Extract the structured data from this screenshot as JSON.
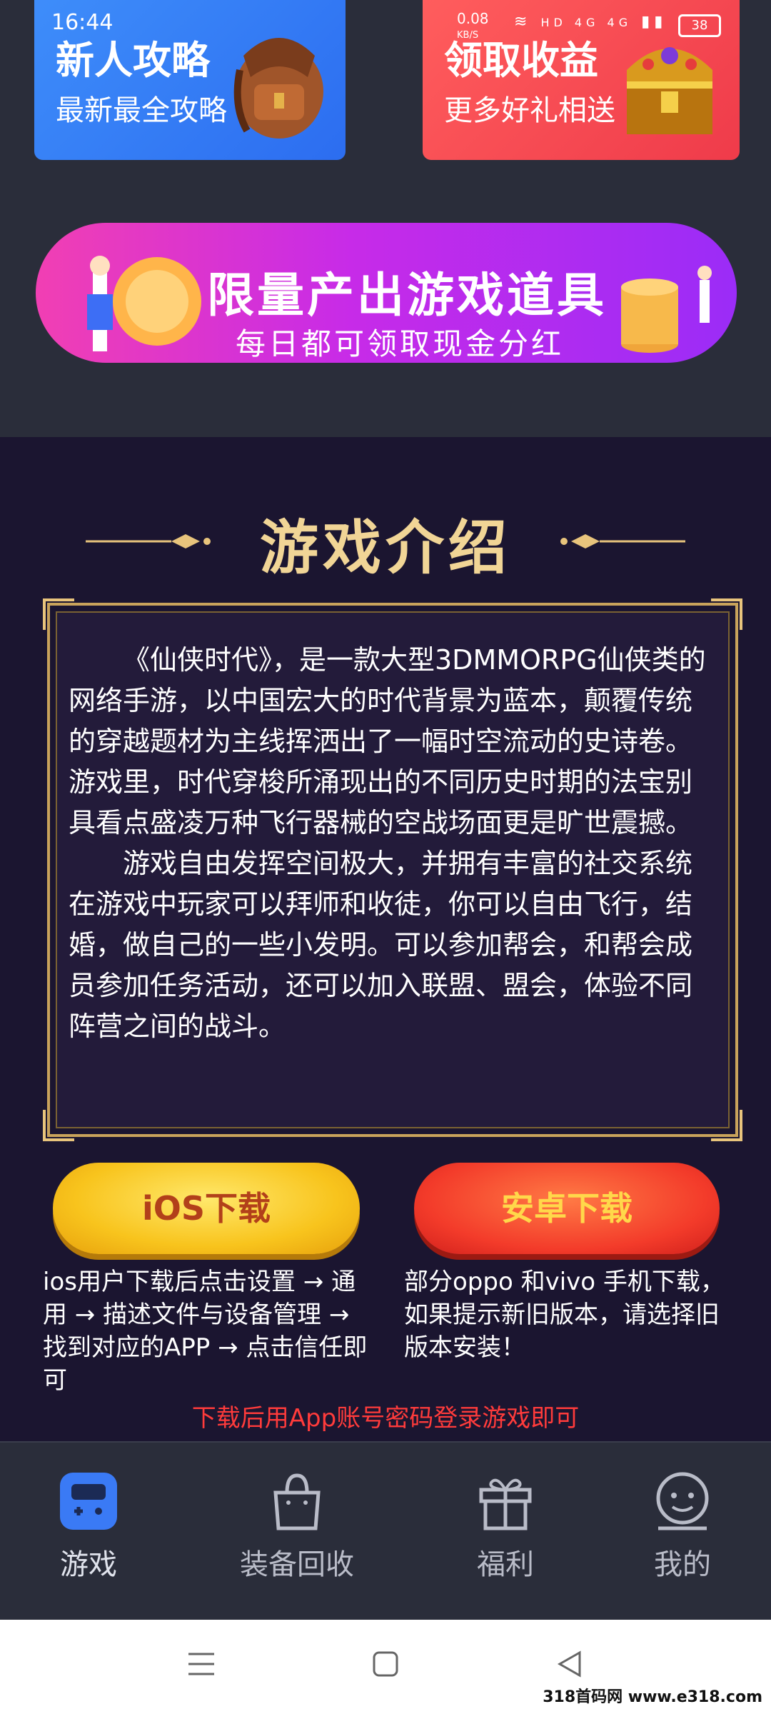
{
  "status_bar": {
    "time": "16:44",
    "net_speed": "0.08",
    "net_unit": "KB/S",
    "indicators": "HD 4G 4G",
    "battery": "38"
  },
  "cards": [
    {
      "title": "新人攻略",
      "subtitle": "最新最全攻略",
      "icon": "backpack-icon"
    },
    {
      "title": "领取收益",
      "subtitle": "更多好礼相送",
      "icon": "treasure-chest-icon"
    }
  ],
  "banner": {
    "title": "限量产出游戏道具",
    "subtitle": "每日都可领取现金分红"
  },
  "section_title": "游戏介绍",
  "description": [
    "《仙侠时代》，是一款大型3DMMORPG仙侠类的网络手游，以中国宏大的时代背景为蓝本，颠覆传统的穿越题材为主线挥洒出了一幅时空流动的史诗卷。游戏里，时代穿梭所涌现出的不同历史时期的法宝别具看点盛凌万种飞行器械的空战场面更是旷世震撼。",
    "游戏自由发挥空间极大，并拥有丰富的社交系统在游戏中玩家可以拜师和收徒，你可以自由飞行，结婚，做自己的一些小发明。可以参加帮会，和帮会成员参加任务活动，还可以加入联盟、盟会，体验不同阵营之间的战斗。"
  ],
  "buttons": {
    "ios": "iOS下载",
    "android": "安卓下载"
  },
  "notes": {
    "ios": "ios用户下载后点击设置 → 通用 → 描述文件与设备管理 → 找到对应的APP → 点击信任即可",
    "android": "部分oppo 和vivo 手机下载，如果提示新旧版本，请选择旧版本安装！"
  },
  "login_tip": "下载后用App账号密码登录游戏即可",
  "nav": [
    {
      "label": "游戏",
      "icon": "gamepad-icon",
      "active": true
    },
    {
      "label": "装备回收",
      "icon": "bag-icon",
      "active": false
    },
    {
      "label": "福利",
      "icon": "gift-icon",
      "active": false
    },
    {
      "label": "我的",
      "icon": "smiley-icon",
      "active": false
    }
  ],
  "watermark": "318首码网 www.e318.com"
}
